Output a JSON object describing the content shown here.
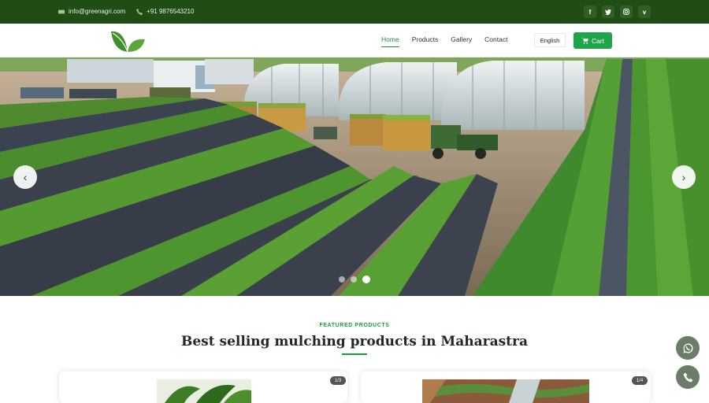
{
  "topbar": {
    "email": "info@greenagri.com",
    "phone": "+91 9876543210",
    "socials": [
      "f",
      "t",
      "ig",
      "v"
    ]
  },
  "header": {
    "nav": [
      {
        "label": "Home",
        "active": true
      },
      {
        "label": "Products",
        "active": false
      },
      {
        "label": "Gallery",
        "active": false
      },
      {
        "label": "Contact",
        "active": false
      }
    ],
    "language": "English",
    "cart_label": "Cart"
  },
  "hero": {
    "slides": 3,
    "active_slide": 3
  },
  "featured": {
    "label": "FEATURED PRODUCTS",
    "title": "Best selling mulching products in Maharastra"
  },
  "cards": [
    {
      "counter": "1/3"
    },
    {
      "counter": "1/4"
    }
  ],
  "colors": {
    "brand_dark": "#1f4d14",
    "accent": "#1ea44a"
  },
  "icons": {
    "email": "envelope-icon",
    "phone": "phone-icon",
    "cart": "cart-icon",
    "prev": "chevron-left-icon",
    "next": "chevron-right-icon",
    "whatsapp": "whatsapp-icon",
    "call": "phone-icon"
  }
}
